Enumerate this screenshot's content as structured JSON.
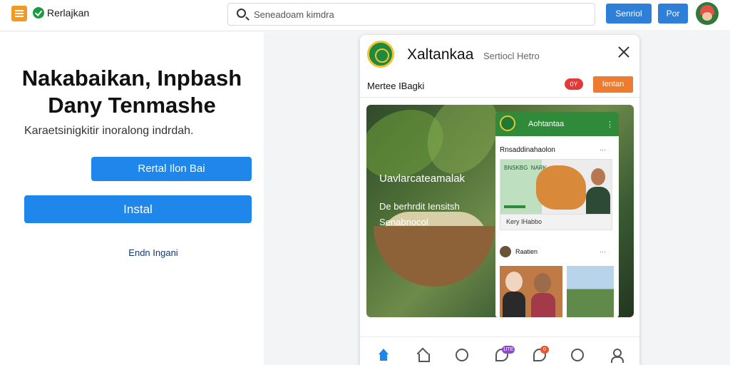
{
  "topbar": {
    "brand": "Rerlajkan",
    "search_placeholder": "Seneadoam kimdra",
    "button1": "Senriol",
    "button2": "Por"
  },
  "hero": {
    "title_line1": "Nakabaikan, Inpbash",
    "title_line2": "Dany Tenmashe",
    "subtitle": "Karaetsinigkitir inoralong indrdah.",
    "button_primary": "Rertal Ilon Bai",
    "button_install": "Instal",
    "link": "Endn Ingani"
  },
  "modal": {
    "title": "Xaltankaa",
    "subtitle": "Sertiocl Hetro",
    "row_label": "Mertee IBagki",
    "pill": "0Y",
    "row_button": "Ientan",
    "photo": {
      "line1": "Uavlarcateamalak",
      "line2": "De berhrdit Iensitsh",
      "line3": "Senabnocol"
    },
    "phone": {
      "header_title": "Aohtantaa",
      "header_menu": "⋮",
      "card1_label": "Rnsaddinahaolon",
      "card1_more": "···",
      "card1_news_text": "BNSKBG NARK",
      "card1_caption": "Kery IHabbo",
      "section_label": "Raatien",
      "section_more": "···"
    },
    "nav": {
      "chat_badge": "1ITE",
      "notif_badge": "0"
    }
  }
}
